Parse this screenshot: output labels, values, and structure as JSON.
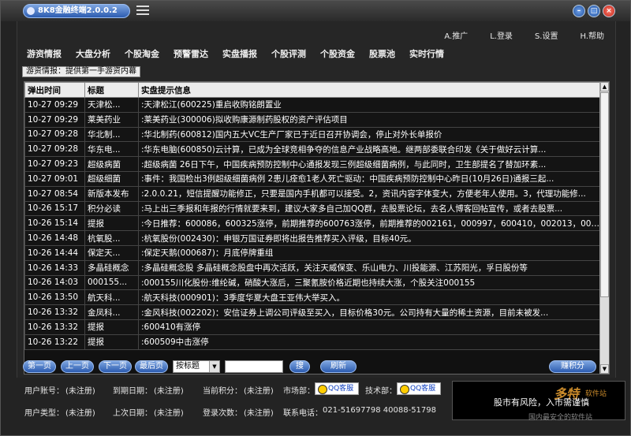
{
  "window": {
    "title": "8K8金融终端2.0.0.2"
  },
  "toplinks": [
    "A.推广",
    "L.登录",
    "S.设置",
    "H.帮助"
  ],
  "nav": [
    "游资情报",
    "大盘分析",
    "个股淘金",
    "预警雷达",
    "实盘播报",
    "个股评测",
    "个股资金",
    "股票池",
    "实时行情"
  ],
  "breadcrumb": "游资情报：提供第一手游资内幕",
  "table": {
    "headers": [
      "弹出时间",
      "标题",
      "实盘提示信息"
    ],
    "rows": [
      [
        "10-27 09:29",
        "天津松...",
        ":天津松江(600225)重启收购铭朗置业"
      ],
      [
        "10-27 09:29",
        "莱美药业",
        ":莱美药业(300006)拟收购康源制药股权的资产评估项目"
      ],
      [
        "10-27 09:28",
        "华北制...",
        ":华北制药(600812)国内五大VC生产厂家已于近日召开协调会，停止对外长单报价"
      ],
      [
        "10-27 09:28",
        "华东电...",
        ":华东电脑(600850)云计算，已成为全球竞相争夺的信息产业战略高地。继两部委联合印发《关于做好云计算..."
      ],
      [
        "10-27 09:23",
        "超级病菌",
        ":超级病菌 26日下午，中国疾病预防控制中心通报发现三例超级细菌病例，与此同时，卫生部提名了替加环素..."
      ],
      [
        "10-27 09:01",
        "超级细菌",
        ":事件：我国检出3例超级细菌病例 2患儿痊愈1老人死亡驱动：中国疾病预防控制中心昨日(10月26日)通报三起..."
      ],
      [
        "10-27 08:54",
        "新版本发布",
        ":2.0.0.21，短信提醒功能修正，只要是国内手机都可以接受。2，资讯内容字体变大，方便老年人使用。3，代理功能修..."
      ],
      [
        "10-26 15:17",
        "积分必读",
        ":马上出三季报和年报的行情就要来到，建议大家多自己加QQ群，去股票论坛，去名人博客回帖宣传，或者去股票..."
      ],
      [
        "10-26 15:14",
        "提报",
        ":今日推荐：600086，600325涨停，前期推荐的600763涨停，前期推荐的002161，000997，600410，002013，000996涨..."
      ],
      [
        "10-26 14:48",
        "杭氧股...",
        ":杭氧股份(002430)：申银万国证券即将出报告推荐买入评级，目标40元。"
      ],
      [
        "10-26 14:44",
        "保定天...",
        ":保定天鹅(000687)：月底停牌重组"
      ],
      [
        "10-26 14:33",
        "多晶硅概念",
        ":多晶硅概念股 多晶硅概念股盘中再次活跃，关注天威保变、乐山电力、川投能源、江苏阳光，孚日股份等"
      ],
      [
        "10-26 14:03",
        "000155...",
        ":000155川化股份:维纶碱，硝酸大涨后，三聚氰胺价格近期也持续大涨，个股关注000155"
      ],
      [
        "10-26 13:50",
        "航天科...",
        ":航天科技(000901)：3季度华夏大盘王亚伟大举买入。"
      ],
      [
        "10-26 13:32",
        "金凤科...",
        ":金风科技(002202)：安信证券上调公司评级至买入，目标价格30元。公司持有大量的稀土资源，目前未被发..."
      ],
      [
        "10-26 13:32",
        "提报",
        ":600410有涨停"
      ],
      [
        "10-26 13:22",
        "提报",
        ":600509中击涨停"
      ]
    ]
  },
  "pager": {
    "first": "第一页",
    "prev": "上一页",
    "next": "下一页",
    "last": "最后页",
    "select_value": "按标题",
    "search": "搜",
    "refresh": "刷新",
    "exchange": "赚积分"
  },
  "info": {
    "account_label": "用户账号：",
    "account_value": "(未注册)",
    "expire_label": "到期日期：",
    "expire_value": "(未注册)",
    "points_label": "当前积分：",
    "points_value": "(未注册)",
    "market_label": "市场部：",
    "qq1": "QQ客服",
    "tech_label": "技术部：",
    "qq2": "QQ客服",
    "type_label": "用户类型：",
    "type_value": "(未注册)",
    "last_label": "上次日期：",
    "last_value": "(未注册)",
    "login_label": "登录次数：",
    "login_value": "(未注册)",
    "phone_label": "联系电话：",
    "phone_value": "021-51697798 40088-51798"
  },
  "ticker": {
    "text": "股市有风险，入市需谨慎",
    "watermark": "多特",
    "watermark2": "软件站",
    "sub": "国内最安全的软件站"
  }
}
